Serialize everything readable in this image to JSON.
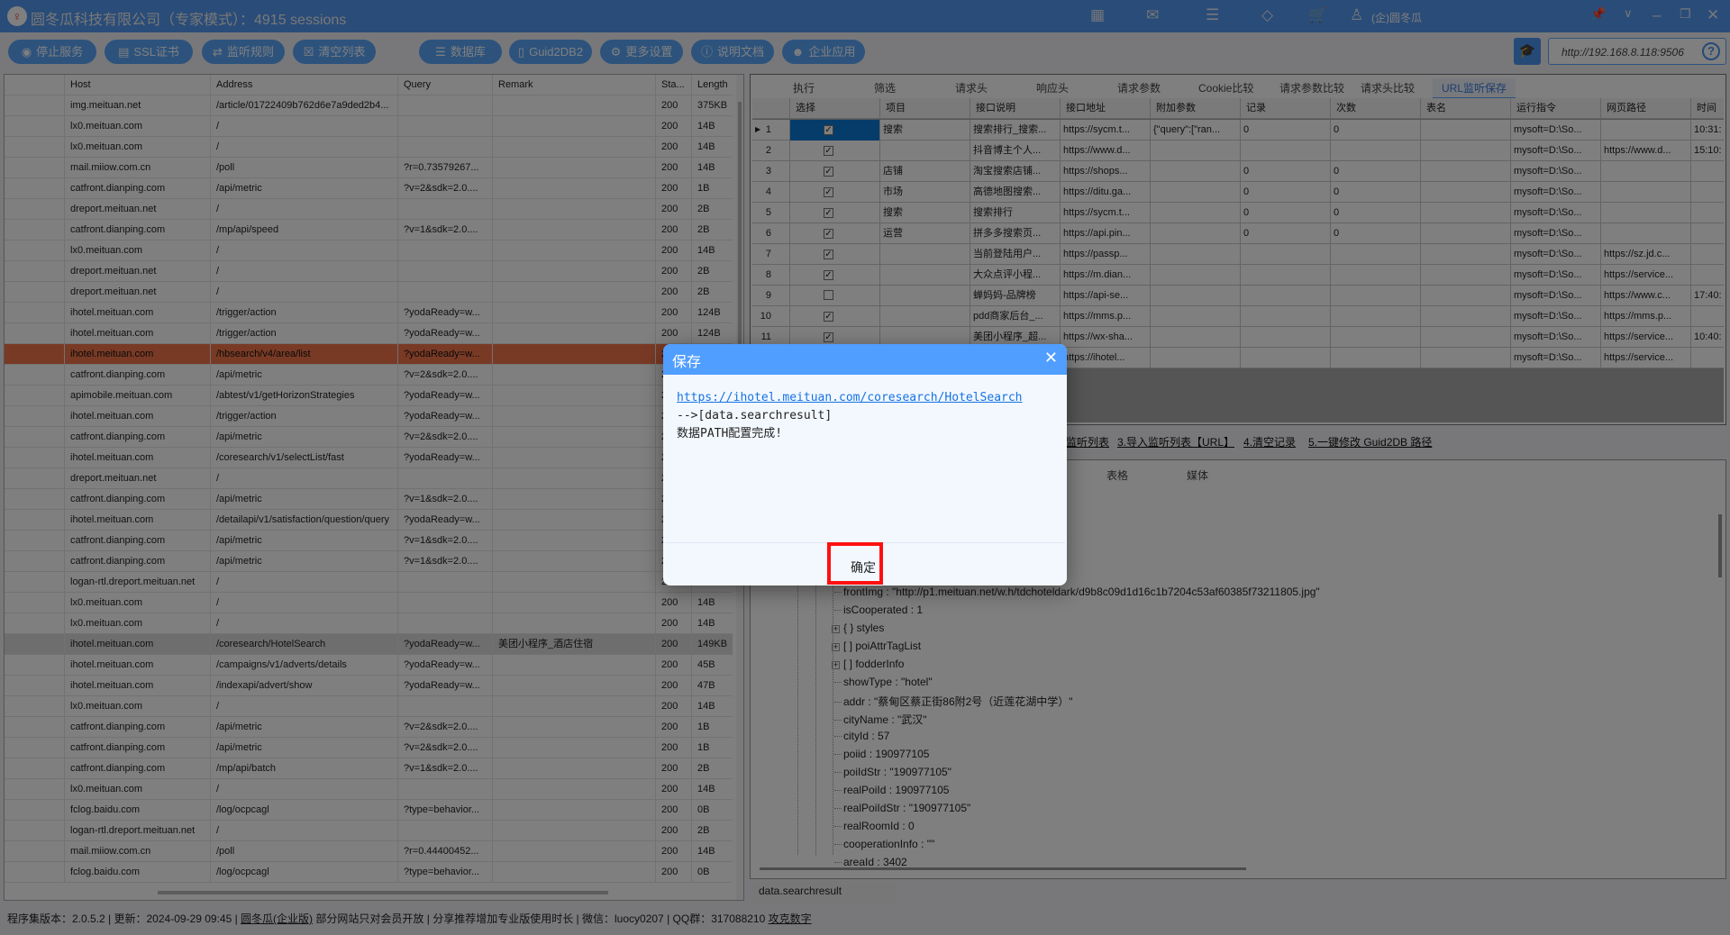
{
  "title": {
    "app": "圆冬瓜科技有限公司（专家模式）：4915 sessions",
    "user": "(企)圆冬瓜",
    "icons": [
      "grid-icon",
      "mail-icon",
      "database-icon",
      "diamond-icon",
      "cart-icon",
      "user-icon"
    ]
  },
  "toolbar": {
    "buttons": [
      {
        "label": "停止服务",
        "icon": "stop-icon"
      },
      {
        "label": "SSL证书",
        "icon": "certificate-icon"
      },
      {
        "label": "监听规则",
        "icon": "swap-icon"
      },
      {
        "label": "清空列表",
        "icon": "clear-icon"
      },
      {
        "label": "数据库",
        "icon": "database-icon"
      },
      {
        "label": "Guid2DB2",
        "icon": "document-icon"
      },
      {
        "label": "更多设置",
        "icon": "gear-icon"
      },
      {
        "label": "说明文档",
        "icon": "help-icon"
      },
      {
        "label": "企业应用",
        "icon": "brain-icon"
      }
    ],
    "url": "http://192.168.8.118:9506"
  },
  "sessions": {
    "columns": [
      "Host",
      "Address",
      "Query",
      "Remark",
      "Sta...",
      "Length"
    ],
    "rows": [
      [
        "img.meituan.net",
        "/article/01722409b762d6e7a9ded2b4...",
        "",
        "",
        "200",
        "375KB"
      ],
      [
        "lx0.meituan.com",
        "/",
        "",
        "",
        "200",
        "14B"
      ],
      [
        "lx0.meituan.com",
        "/",
        "",
        "",
        "200",
        "14B"
      ],
      [
        "mail.miiow.com.cn",
        "/poll",
        "?r=0.73579267...",
        "",
        "200",
        "14B"
      ],
      [
        "catfront.dianping.com",
        "/api/metric",
        "?v=2&sdk=2.0....",
        "",
        "200",
        "1B"
      ],
      [
        "dreport.meituan.net",
        "/",
        "",
        "",
        "200",
        "2B"
      ],
      [
        "catfront.dianping.com",
        "/mp/api/speed",
        "?v=1&sdk=2.0....",
        "",
        "200",
        "2B"
      ],
      [
        "lx0.meituan.com",
        "/",
        "",
        "",
        "200",
        "14B"
      ],
      [
        "dreport.meituan.net",
        "/",
        "",
        "",
        "200",
        "2B"
      ],
      [
        "dreport.meituan.net",
        "/",
        "",
        "",
        "200",
        "2B"
      ],
      [
        "ihotel.meituan.com",
        "/trigger/action",
        "?yodaReady=w...",
        "",
        "200",
        "124B"
      ],
      [
        "ihotel.meituan.com",
        "/trigger/action",
        "?yodaReady=w...",
        "",
        "200",
        "124B"
      ],
      [
        "ihotel.meituan.com",
        "/hbsearch/v4/area/list",
        "?yodaReady=w...",
        "",
        "20",
        ""
      ],
      [
        "catfront.dianping.com",
        "/api/metric",
        "?v=2&sdk=2.0....",
        "",
        "20",
        ""
      ],
      [
        "apimobile.meituan.com",
        "/abtest/v1/getHorizonStrategies",
        "?yodaReady=w...",
        "",
        "20",
        ""
      ],
      [
        "ihotel.meituan.com",
        "/trigger/action",
        "?yodaReady=w...",
        "",
        "20",
        ""
      ],
      [
        "catfront.dianping.com",
        "/api/metric",
        "?v=2&sdk=2.0....",
        "",
        "20",
        ""
      ],
      [
        "ihotel.meituan.com",
        "/coresearch/v1/selectList/fast",
        "?yodaReady=w...",
        "",
        "20",
        ""
      ],
      [
        "dreport.meituan.net",
        "/",
        "",
        "",
        "20",
        ""
      ],
      [
        "catfront.dianping.com",
        "/api/metric",
        "?v=1&sdk=2.0....",
        "",
        "20",
        ""
      ],
      [
        "ihotel.meituan.com",
        "/detailapi/v1/satisfaction/question/query",
        "?yodaReady=w...",
        "",
        "20",
        ""
      ],
      [
        "catfront.dianping.com",
        "/api/metric",
        "?v=1&sdk=2.0....",
        "",
        "20",
        ""
      ],
      [
        "catfront.dianping.com",
        "/api/metric",
        "?v=1&sdk=2.0....",
        "",
        "20",
        ""
      ],
      [
        "logan-rtl.dreport.meituan.net",
        "/",
        "",
        "",
        "20",
        ""
      ],
      [
        "lx0.meituan.com",
        "/",
        "",
        "",
        "200",
        "14B"
      ],
      [
        "lx0.meituan.com",
        "/",
        "",
        "",
        "200",
        "14B"
      ],
      [
        "ihotel.meituan.com",
        "/coresearch/HotelSearch",
        "?yodaReady=w...",
        "美团小程序_酒店住宿",
        "200",
        "149KB"
      ],
      [
        "ihotel.meituan.com",
        "/campaigns/v1/adverts/details",
        "?yodaReady=w...",
        "",
        "200",
        "45B"
      ],
      [
        "ihotel.meituan.com",
        "/indexapi/advert/show",
        "?yodaReady=w...",
        "",
        "200",
        "47B"
      ],
      [
        "lx0.meituan.com",
        "/",
        "",
        "",
        "200",
        "14B"
      ],
      [
        "catfront.dianping.com",
        "/api/metric",
        "?v=2&sdk=2.0....",
        "",
        "200",
        "1B"
      ],
      [
        "catfront.dianping.com",
        "/api/metric",
        "?v=2&sdk=2.0....",
        "",
        "200",
        "1B"
      ],
      [
        "catfront.dianping.com",
        "/mp/api/batch",
        "?v=1&sdk=2.0....",
        "",
        "200",
        "2B"
      ],
      [
        "lx0.meituan.com",
        "/",
        "",
        "",
        "200",
        "14B"
      ],
      [
        "fclog.baidu.com",
        "/log/ocpcagl",
        "?type=behavior...",
        "",
        "200",
        "0B"
      ],
      [
        "logan-rtl.dreport.meituan.net",
        "/",
        "",
        "",
        "200",
        "2B"
      ],
      [
        "mail.miiow.com.cn",
        "/poll",
        "?r=0.44400452...",
        "",
        "200",
        "14B"
      ],
      [
        "fclog.baidu.com",
        "/log/ocpcagl",
        "?type=behavior...",
        "",
        "200",
        "0B"
      ]
    ],
    "selected_index": 12,
    "highlighted_index": 26
  },
  "detail_tabs": {
    "items": [
      "执行",
      "筛选",
      "请求头",
      "响应头",
      "请求参数",
      "Cookie比较",
      "请求参数比较",
      "请求头比较",
      "URL监听保存"
    ],
    "active": 8
  },
  "monitor": {
    "columns": [
      "选择",
      "项目",
      "接口说明",
      "接口地址",
      "附加参数",
      "记录",
      "次数",
      "表名",
      "运行指令",
      "网页路径",
      "时间"
    ],
    "rows": [
      {
        "n": "1",
        "checked": true,
        "cells": [
          "搜索",
          "搜索排行_搜索...",
          "https://sycm.t...",
          "{\"query\":[\"ran...",
          "0",
          "0",
          "",
          "mysoft=D:\\So...",
          "",
          "10:31:"
        ]
      },
      {
        "n": "2",
        "checked": true,
        "cells": [
          "",
          "抖音博主个人...",
          "https://www.d...",
          "",
          "",
          "",
          "",
          "mysoft=D:\\So...",
          "https://www.d...",
          "15:10:"
        ]
      },
      {
        "n": "3",
        "checked": true,
        "cells": [
          "店铺",
          "淘宝搜索店铺...",
          "https://shops...",
          "",
          "0",
          "0",
          "",
          "mysoft=D:\\So...",
          "",
          ""
        ]
      },
      {
        "n": "4",
        "checked": true,
        "cells": [
          "市场",
          "高德地图搜索...",
          "https://ditu.ga...",
          "",
          "0",
          "0",
          "",
          "mysoft=D:\\So...",
          "",
          ""
        ]
      },
      {
        "n": "5",
        "checked": true,
        "cells": [
          "搜索",
          "搜索排行",
          "https://sycm.t...",
          "",
          "0",
          "0",
          "",
          "mysoft=D:\\So...",
          "",
          ""
        ]
      },
      {
        "n": "6",
        "checked": true,
        "cells": [
          "运营",
          "拼多多搜索页...",
          "https://api.pin...",
          "",
          "0",
          "0",
          "",
          "mysoft=D:\\So...",
          "",
          ""
        ]
      },
      {
        "n": "7",
        "checked": true,
        "cells": [
          "",
          "当前登陆用户...",
          "https://passp...",
          "",
          "",
          "",
          "",
          "mysoft=D:\\So...",
          "https://sz.jd.c...",
          ""
        ]
      },
      {
        "n": "8",
        "checked": true,
        "cells": [
          "",
          "大众点评小程...",
          "https://m.dian...",
          "",
          "",
          "",
          "",
          "mysoft=D:\\So...",
          "https://service...",
          ""
        ]
      },
      {
        "n": "9",
        "checked": false,
        "cells": [
          "",
          "蝉妈妈-品牌榜",
          "https://api-se...",
          "",
          "",
          "",
          "",
          "mysoft=D:\\So...",
          "https://www.c...",
          "17:40:"
        ]
      },
      {
        "n": "10",
        "checked": true,
        "cells": [
          "",
          "pdd商家后台_...",
          "https://mms.p...",
          "",
          "",
          "",
          "",
          "mysoft=D:\\So...",
          "https://mms.p...",
          ""
        ]
      },
      {
        "n": "11",
        "checked": true,
        "cells": [
          "",
          "美团小程序_超...",
          "https://wx-sha...",
          "",
          "",
          "",
          "",
          "mysoft=D:\\So...",
          "https://service...",
          "10:40:"
        ]
      },
      {
        "n": "12",
        "checked": true,
        "cells": [
          "",
          "",
          "https://ihotel...",
          "",
          "",
          "",
          "",
          "mysoft=D:\\So...",
          "https://service...",
          ""
        ]
      }
    ]
  },
  "actions": [
    "监听列表",
    "3.导入监听列表【URL】",
    "4.清空记录",
    "5.一键修改 Guid2DB 路径"
  ],
  "lower_tabs": [
    "表格",
    "媒体"
  ],
  "tree": [
    {
      "text": "frontImg : \"http://p1.meituan.net/w.h/tdchoteldark/d9b8c09d1d16c1b7204c53af60385f73211805.jpg\"",
      "exp": false
    },
    {
      "text": "isCooperated : 1",
      "exp": false
    },
    {
      "text": "{ } styles",
      "exp": true
    },
    {
      "text": "[ ] poiAttrTagList",
      "exp": true
    },
    {
      "text": "[ ] fodderInfo",
      "exp": true
    },
    {
      "text": "showType : \"hotel\"",
      "exp": false
    },
    {
      "text": "addr : \"蔡甸区蔡正街86附2号（近莲花湖中学）\"",
      "exp": false
    },
    {
      "text": "cityName : \"武汉\"",
      "exp": false
    },
    {
      "text": "cityId : 57",
      "exp": false
    },
    {
      "text": "poiid : 190977105",
      "exp": false
    },
    {
      "text": "poiIdStr : \"190977105\"",
      "exp": false
    },
    {
      "text": "realPoiId : 190977105",
      "exp": false
    },
    {
      "text": "realPoiIdStr : \"190977105\"",
      "exp": false
    },
    {
      "text": "realRoomId : 0",
      "exp": false
    },
    {
      "text": "cooperationInfo : \"\"",
      "exp": false
    },
    {
      "text": "areaId : 3402",
      "exp": false
    }
  ],
  "path_field": "data.searchresult",
  "status": {
    "version": "程序集版本：2.0.5.2",
    "updated": "更新：2024-09-29 09:45",
    "edition": "圆冬瓜(企业版)",
    "note1": "部分网站只对会员开放",
    "note2": "分享推荐增加专业版使用时长",
    "wechat": "微信：luocy0207",
    "qq": "QQ群：317088210",
    "link": "攻克数字"
  },
  "dialog": {
    "title": "保存",
    "url": "https://ihotel.meituan.com/coresearch/HotelSearch",
    "path": "-->[data.searchresult]",
    "message": "数据PATH配置完成!",
    "ok": "确定"
  }
}
